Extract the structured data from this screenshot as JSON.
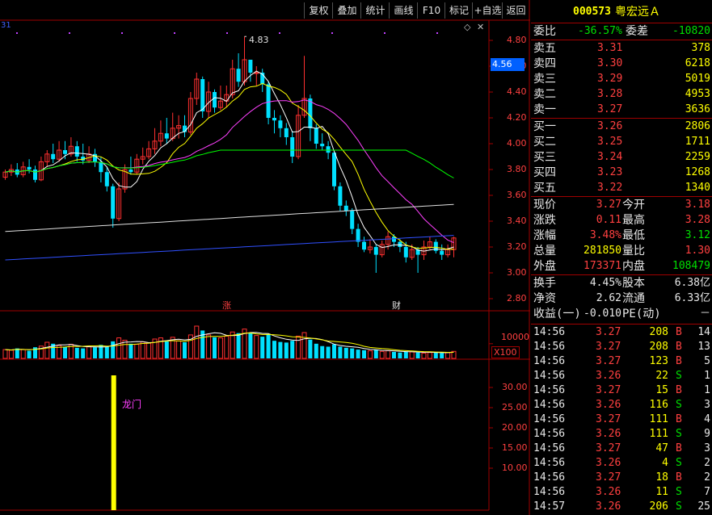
{
  "toolbar": [
    "复权",
    "叠加",
    "统计",
    "画线",
    "F10",
    "标记",
    "+自选",
    "返回"
  ],
  "stock": {
    "code": "000573",
    "name": "粤宏远Ａ"
  },
  "chart": {
    "price_labels": [
      "4.80",
      "4.60",
      "4.40",
      "4.20",
      "4.00",
      "3.80",
      "3.60",
      "3.40",
      "3.20",
      "3.00",
      "2.80"
    ],
    "current_price_tag": "4.56",
    "high_mark": "4.83",
    "marker_zhang": "涨",
    "marker_cai": "财",
    "volume_label": "10000",
    "volume_unit": "X100",
    "indicator_labels": [
      "30.00",
      "25.00",
      "20.00",
      "15.00",
      "10.00"
    ],
    "indicator_text": "龙门",
    "left_tag": "31"
  },
  "colors": {
    "up": "#ff3030",
    "down": "#00e0ff",
    "ma5": "#ffffff",
    "ma10": "#ffff00",
    "ma20": "#ff40ff",
    "ma60": "#00ff00",
    "ma120": "#e0e0e0",
    "ma250": "#3050ff",
    "grid": "#a00000",
    "signal": "#ffff00"
  },
  "quote": {
    "weibi": {
      "label": "委比",
      "value": "-36.57%",
      "label2": "委差",
      "value2": "-10820"
    },
    "asks": [
      {
        "label": "卖五",
        "price": "3.31",
        "vol": "378"
      },
      {
        "label": "卖四",
        "price": "3.30",
        "vol": "6218"
      },
      {
        "label": "卖三",
        "price": "3.29",
        "vol": "5019"
      },
      {
        "label": "卖二",
        "price": "3.28",
        "vol": "4953"
      },
      {
        "label": "卖一",
        "price": "3.27",
        "vol": "3636"
      }
    ],
    "bids": [
      {
        "label": "买一",
        "price": "3.26",
        "vol": "2806"
      },
      {
        "label": "买二",
        "price": "3.25",
        "vol": "1711"
      },
      {
        "label": "买三",
        "price": "3.24",
        "vol": "2259"
      },
      {
        "label": "买四",
        "price": "3.23",
        "vol": "1268"
      },
      {
        "label": "买五",
        "price": "3.22",
        "vol": "1340"
      }
    ],
    "stats": [
      {
        "l1": "现价",
        "v1": "3.27",
        "l2": "今开",
        "v2": "3.18"
      },
      {
        "l1": "涨跌",
        "v1": "0.11",
        "l2": "最高",
        "v2": "3.28"
      },
      {
        "l1": "涨幅",
        "v1": "3.48%",
        "l2": "最低",
        "v2": "3.12"
      },
      {
        "l1": "总量",
        "v1": "281850",
        "l2": "量比",
        "v2": "1.30"
      },
      {
        "l1": "外盘",
        "v1": "173371",
        "l2": "内盘",
        "v2": "108479"
      }
    ],
    "extra": [
      {
        "l1": "换手",
        "v1": "4.45%",
        "l2": "股本",
        "v2": "6.38亿"
      },
      {
        "l1": "净资",
        "v1": "2.62",
        "l2": "流通",
        "v2": "6.33亿"
      },
      {
        "l1": "收益(一)",
        "v1": "-0.010",
        "l2": "PE(动)",
        "v2": "－"
      }
    ]
  },
  "ticks": [
    {
      "t": "14:56",
      "p": "3.27",
      "v": "208",
      "s": "B",
      "n": "14"
    },
    {
      "t": "14:56",
      "p": "3.27",
      "v": "208",
      "s": "B",
      "n": "13"
    },
    {
      "t": "14:56",
      "p": "3.27",
      "v": "123",
      "s": "B",
      "n": "5"
    },
    {
      "t": "14:56",
      "p": "3.26",
      "v": "22",
      "s": "S",
      "n": "1"
    },
    {
      "t": "14:56",
      "p": "3.27",
      "v": "15",
      "s": "B",
      "n": "1"
    },
    {
      "t": "14:56",
      "p": "3.26",
      "v": "116",
      "s": "S",
      "n": "3"
    },
    {
      "t": "14:56",
      "p": "3.27",
      "v": "111",
      "s": "B",
      "n": "4"
    },
    {
      "t": "14:56",
      "p": "3.26",
      "v": "111",
      "s": "S",
      "n": "9"
    },
    {
      "t": "14:56",
      "p": "3.27",
      "v": "47",
      "s": "B",
      "n": "3"
    },
    {
      "t": "14:56",
      "p": "3.26",
      "v": "4",
      "s": "S",
      "n": "2"
    },
    {
      "t": "14:56",
      "p": "3.27",
      "v": "18",
      "s": "B",
      "n": "2"
    },
    {
      "t": "14:56",
      "p": "3.26",
      "v": "11",
      "s": "S",
      "n": "7"
    },
    {
      "t": "14:57",
      "p": "3.26",
      "v": "206",
      "s": "S",
      "n": "25"
    }
  ],
  "candles": [
    [
      3.74,
      3.78,
      3.8,
      3.72
    ],
    [
      3.78,
      3.8,
      3.84,
      3.75
    ],
    [
      3.8,
      3.76,
      3.85,
      3.74
    ],
    [
      3.76,
      3.82,
      3.86,
      3.74
    ],
    [
      3.82,
      3.8,
      3.88,
      3.77
    ],
    [
      3.8,
      3.72,
      3.83,
      3.7
    ],
    [
      3.72,
      3.86,
      3.9,
      3.71
    ],
    [
      3.86,
      3.92,
      3.95,
      3.82
    ],
    [
      3.92,
      3.88,
      4.0,
      3.85
    ],
    [
      3.88,
      3.95,
      4.02,
      3.86
    ],
    [
      3.95,
      3.92,
      4.02,
      3.88
    ],
    [
      3.92,
      3.98,
      4.05,
      3.9
    ],
    [
      3.98,
      3.9,
      4.02,
      3.86
    ],
    [
      3.9,
      3.87,
      4.0,
      3.84
    ],
    [
      3.87,
      3.92,
      3.98,
      3.85
    ],
    [
      3.92,
      3.86,
      3.96,
      3.82
    ],
    [
      3.86,
      3.78,
      3.9,
      3.7
    ],
    [
      3.78,
      3.67,
      3.82,
      3.63
    ],
    [
      3.67,
      3.42,
      3.69,
      3.35
    ],
    [
      3.42,
      3.65,
      3.7,
      3.4
    ],
    [
      3.65,
      3.8,
      3.84,
      3.62
    ],
    [
      3.8,
      3.78,
      3.9,
      3.76
    ],
    [
      3.78,
      3.88,
      3.92,
      3.76
    ],
    [
      3.88,
      3.9,
      3.97,
      3.84
    ],
    [
      3.9,
      3.96,
      4.02,
      3.88
    ],
    [
      3.96,
      4.02,
      4.12,
      3.92
    ],
    [
      4.02,
      4.08,
      4.18,
      3.98
    ],
    [
      4.08,
      4.04,
      4.2,
      4.0
    ],
    [
      4.04,
      4.12,
      4.24,
      4.02
    ],
    [
      4.12,
      4.14,
      4.22,
      4.04
    ],
    [
      4.14,
      4.09,
      4.22,
      4.05
    ],
    [
      4.09,
      4.35,
      4.4,
      4.07
    ],
    [
      4.35,
      4.5,
      4.55,
      4.3
    ],
    [
      4.5,
      4.25,
      4.52,
      4.2
    ],
    [
      4.25,
      4.4,
      4.48,
      4.2
    ],
    [
      4.4,
      4.28,
      4.42,
      4.24
    ],
    [
      4.28,
      4.33,
      4.45,
      4.26
    ],
    [
      4.33,
      4.38,
      4.45,
      4.28
    ],
    [
      4.38,
      4.58,
      4.65,
      4.35
    ],
    [
      4.58,
      4.48,
      4.7,
      4.44
    ],
    [
      4.48,
      4.65,
      4.83,
      4.45
    ],
    [
      4.65,
      4.55,
      4.62,
      4.48
    ],
    [
      4.55,
      4.55,
      4.6,
      4.45
    ],
    [
      4.55,
      4.46,
      4.58,
      4.4
    ],
    [
      4.46,
      4.2,
      4.48,
      4.15
    ],
    [
      4.2,
      4.18,
      4.26,
      4.08
    ],
    [
      4.18,
      4.12,
      4.22,
      4.05
    ],
    [
      4.12,
      4.05,
      4.16,
      3.99
    ],
    [
      4.05,
      3.9,
      4.1,
      3.85
    ],
    [
      3.9,
      4.22,
      4.3,
      3.88
    ],
    [
      4.22,
      4.35,
      4.68,
      4.2
    ],
    [
      4.35,
      4.12,
      4.38,
      4.02
    ],
    [
      4.12,
      4.0,
      4.15,
      3.96
    ],
    [
      4.0,
      3.98,
      4.08,
      3.95
    ],
    [
      3.98,
      3.93,
      4.02,
      3.88
    ],
    [
      3.93,
      3.67,
      3.95,
      3.64
    ],
    [
      3.67,
      3.52,
      3.7,
      3.48
    ],
    [
      3.52,
      3.48,
      3.56,
      3.44
    ],
    [
      3.48,
      3.34,
      3.5,
      3.3
    ],
    [
      3.34,
      3.24,
      3.38,
      3.2
    ],
    [
      3.24,
      3.18,
      3.28,
      3.16
    ],
    [
      3.18,
      3.2,
      3.26,
      3.15
    ],
    [
      3.2,
      3.14,
      3.22,
      3.0
    ],
    [
      3.14,
      3.22,
      3.25,
      3.12
    ],
    [
      3.22,
      3.28,
      3.32,
      3.18
    ],
    [
      3.28,
      3.24,
      3.3,
      3.2
    ],
    [
      3.24,
      3.2,
      3.26,
      3.16
    ],
    [
      3.2,
      3.12,
      3.24,
      3.08
    ],
    [
      3.12,
      3.18,
      3.22,
      3.1
    ],
    [
      3.18,
      3.14,
      3.2,
      3.0
    ],
    [
      3.14,
      3.2,
      3.25,
      3.1
    ],
    [
      3.2,
      3.24,
      3.28,
      3.18
    ],
    [
      3.24,
      3.17,
      3.26,
      3.15
    ],
    [
      3.17,
      3.14,
      3.22,
      3.1
    ],
    [
      3.14,
      3.18,
      3.22,
      3.12
    ],
    [
      3.18,
      3.27,
      3.28,
      3.12
    ]
  ],
  "volumes": [
    30,
    28,
    34,
    30,
    26,
    38,
    42,
    55,
    50,
    44,
    40,
    48,
    36,
    34,
    40,
    38,
    46,
    40,
    58,
    70,
    62,
    50,
    48,
    56,
    52,
    66,
    70,
    58,
    72,
    60,
    55,
    80,
    110,
    95,
    80,
    72,
    70,
    76,
    90,
    86,
    100,
    88,
    78,
    74,
    82,
    60,
    56,
    54,
    60,
    76,
    88,
    64,
    50,
    42,
    40,
    48,
    40,
    36,
    34,
    30,
    28,
    26,
    30,
    24,
    26,
    22,
    20,
    24,
    22,
    20,
    18,
    20,
    22,
    18,
    20,
    24
  ],
  "signal": {
    "index": 18,
    "value": 33
  }
}
